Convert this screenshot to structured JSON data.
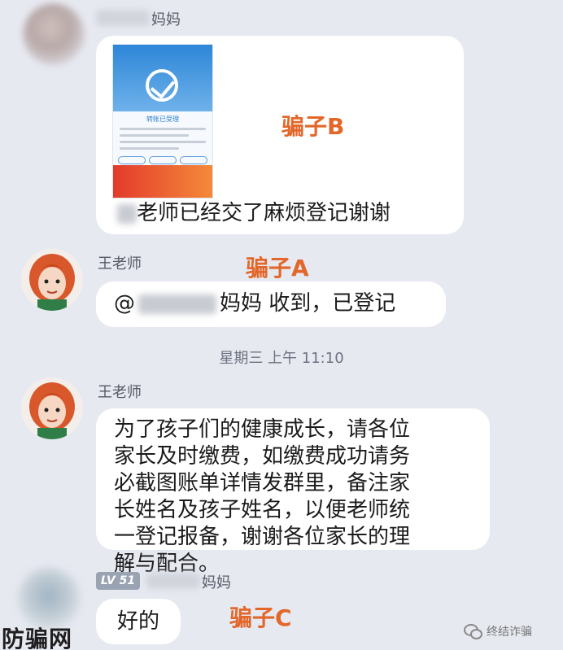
{
  "messages": [
    {
      "sender_suffix": "妈妈",
      "receipt": {
        "title": "转账已受理"
      },
      "text_after_blur": "老师已经交了麻烦登记谢谢"
    },
    {
      "sender": "王老师",
      "mention": "@",
      "text_after_blur": "妈妈 收到，已登记"
    },
    {
      "sender": "王老师",
      "lines": [
        "为了孩子们的健康成长，请各位",
        "家长及时缴费，如缴费成功请务",
        "必截图账单详情发群里，备注家",
        "长姓名及孩子姓名，以便老师统",
        "一登记报备，谢谢各位家长的理",
        "解与配合。"
      ]
    },
    {
      "level_badge": "LV 51",
      "sender_suffix": "妈妈",
      "text": "好的"
    }
  ],
  "timestamp": "星期三 上午 11:10",
  "annotations": {
    "scammer_a": "骗子A",
    "scammer_b": "骗子B",
    "scammer_c": "骗子C"
  },
  "watermarks": {
    "left": "防骗网",
    "right": "终结诈骗"
  },
  "colors": {
    "background": "#e7e9f1",
    "bubble": "#ffffff",
    "annotation": "#e2672a"
  },
  "icons": [
    "teacher-avatar",
    "wechat-icon"
  ]
}
